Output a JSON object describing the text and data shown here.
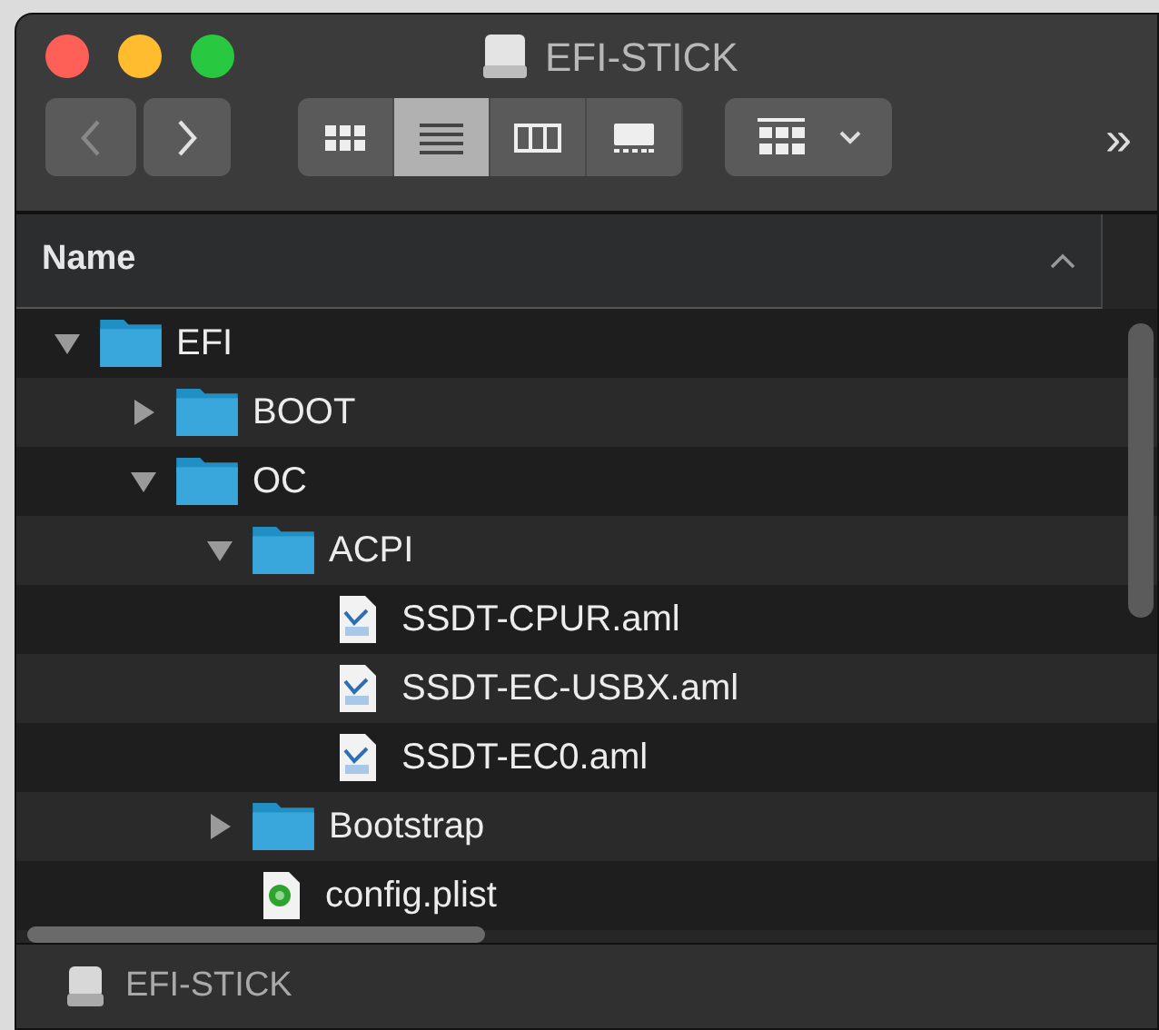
{
  "window": {
    "title": "EFI-STICK"
  },
  "toolbar": {
    "view_buttons": [
      {
        "kind": "icons",
        "selected": false
      },
      {
        "kind": "list",
        "selected": true
      },
      {
        "kind": "columns",
        "selected": false
      },
      {
        "kind": "gallery",
        "selected": false
      }
    ],
    "overflow": "»"
  },
  "header": {
    "label": "Name",
    "sort_ascending": true
  },
  "tree": [
    {
      "name": "EFI",
      "kind": "folder",
      "expanded": true,
      "children": [
        {
          "name": "BOOT",
          "kind": "folder",
          "expanded": false
        },
        {
          "name": "OC",
          "kind": "folder",
          "expanded": true,
          "children": [
            {
              "name": "ACPI",
              "kind": "folder",
              "expanded": true,
              "children": [
                {
                  "name": "SSDT-CPUR.aml",
                  "kind": "document"
                },
                {
                  "name": "SSDT-EC-USBX.aml",
                  "kind": "document"
                },
                {
                  "name": "SSDT-EC0.aml",
                  "kind": "document"
                }
              ]
            },
            {
              "name": "Bootstrap",
              "kind": "folder",
              "expanded": false
            },
            {
              "name": "config.plist",
              "kind": "plist"
            }
          ]
        }
      ]
    }
  ],
  "path_bar": {
    "label": "EFI-STICK"
  }
}
